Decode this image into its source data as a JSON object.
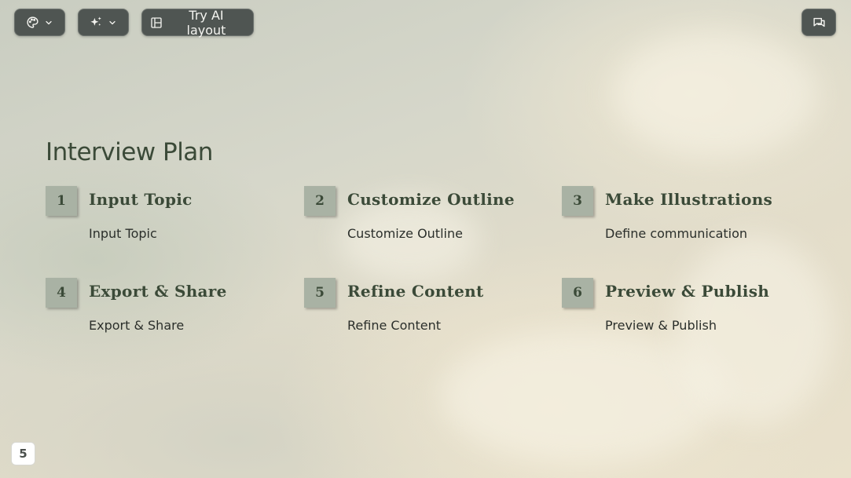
{
  "toolbar": {
    "palette_icon": "palette-icon",
    "magic_icon": "sparkles-icon",
    "ai_layout_icon": "layout-icon",
    "ai_layout_label": "Try AI layout",
    "comment_icon": "comment-icon",
    "dropdown_icon": "chevron-down-icon"
  },
  "slide": {
    "title": "Interview Plan",
    "steps": [
      {
        "number": "1",
        "title": "Input Topic",
        "description": "Input Topic"
      },
      {
        "number": "2",
        "title": "Customize Outline",
        "description": "Customize Outline"
      },
      {
        "number": "3",
        "title": "Make Illustrations",
        "description": "Define communication"
      },
      {
        "number": "4",
        "title": "Export & Share",
        "description": "Export & Share"
      },
      {
        "number": "5",
        "title": "Refine Content",
        "description": "Refine Content"
      },
      {
        "number": "6",
        "title": "Preview & Publish",
        "description": "Preview & Publish"
      }
    ]
  },
  "page_number": "5",
  "colors": {
    "accent_text": "#3b4a38",
    "number_box": "#a9b2a4",
    "toolbar_bg": "#4f5552"
  }
}
